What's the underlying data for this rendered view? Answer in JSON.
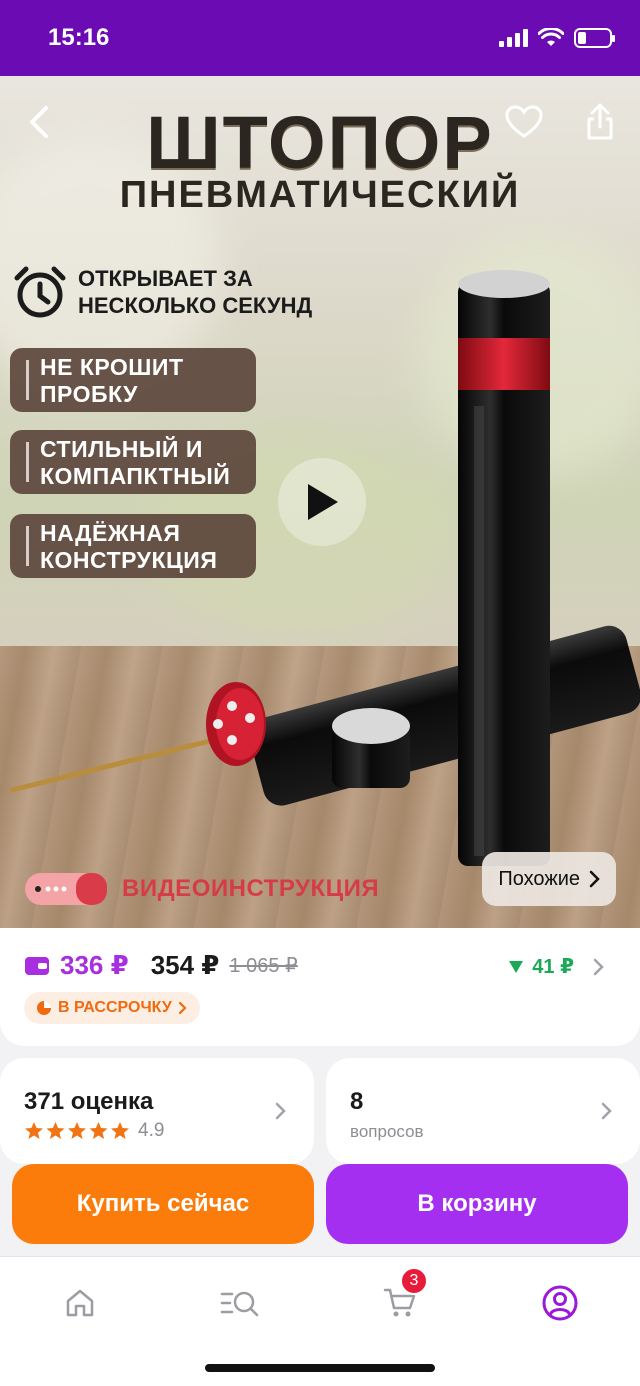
{
  "status": {
    "time": "15:16"
  },
  "hero": {
    "title": "ШТОПОР",
    "subtitle": "ПНЕВМАТИЧЕСКИЙ",
    "feature_main": "ОТКРЫВАЕТ ЗА НЕСКОЛЬКО СЕКУНД",
    "features": [
      "НЕ КРОШИТ ПРОБКУ",
      "СТИЛЬНЫЙ И КОМПАПКТНЫЙ",
      "НАДЁЖНАЯ КОНСТРУКЦИЯ"
    ],
    "video_label": "ВИДЕОИНСТРУКЦИЯ",
    "similar_label": "Похожие"
  },
  "price": {
    "wallet_price": "336 ₽",
    "regular_price": "354 ₽",
    "old_price": "1 065 ₽",
    "price_drop": "41 ₽",
    "installment_label": "В РАССРОЧКУ",
    "accent_color": "#a72fe0",
    "drop_color": "#1ca957"
  },
  "ratings": {
    "count_label": "371 оценка",
    "score": "4.9",
    "stars": 5
  },
  "questions": {
    "count": "8",
    "label": "вопросов"
  },
  "actions": {
    "buy_now": "Купить сейчас",
    "add_to_cart": "В корзину"
  },
  "tabbar": {
    "cart_badge": "3",
    "tabs": [
      "home-icon",
      "catalog-search-icon",
      "cart-icon",
      "profile-icon"
    ]
  }
}
